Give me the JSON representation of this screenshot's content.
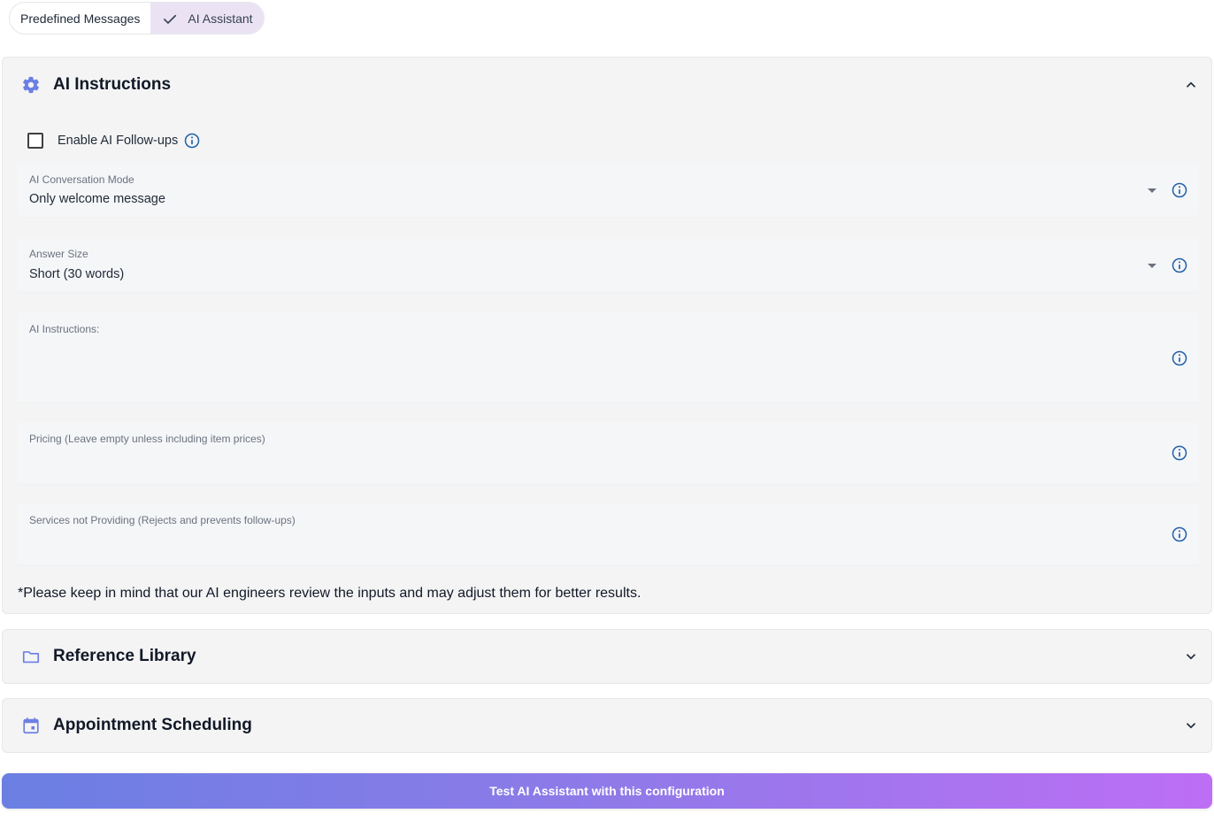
{
  "tabs": {
    "predefined_label": "Predefined Messages",
    "ai_assistant_label": "AI Assistant",
    "active": "AI Assistant"
  },
  "ai_instructions_panel": {
    "title": "AI Instructions",
    "expanded": true,
    "enable_followups": {
      "label": "Enable AI Follow-ups",
      "checked": false
    },
    "conversation_mode": {
      "label": "AI Conversation Mode",
      "value": "Only welcome message"
    },
    "answer_size": {
      "label": "Answer Size",
      "value": "Short (30 words)"
    },
    "instructions": {
      "label": "AI Instructions:",
      "value": ""
    },
    "pricing": {
      "label": "Pricing (Leave empty unless including item prices)",
      "value": ""
    },
    "services_not_providing": {
      "label": "Services not Providing (Rejects and prevents follow-ups)",
      "value": ""
    },
    "note": "*Please keep in mind that our AI engineers review the inputs and may adjust them for better results."
  },
  "reference_library_panel": {
    "title": "Reference Library",
    "expanded": false
  },
  "appointment_panel": {
    "title": "Appointment Scheduling",
    "expanded": false
  },
  "test_button_label": "Test AI Assistant with this configuration",
  "colors": {
    "accent": "#6b7fe3",
    "info_blue": "#1f5fa8",
    "active_tab_bg": "#ebe3f4",
    "gradient_start": "#6b7fe3",
    "gradient_end": "#bd6ef5"
  },
  "icons": {
    "ai_instructions": "gear-icon",
    "reference_library": "folder-icon",
    "appointment": "calendar-icon",
    "info": "info-icon",
    "active_tab": "check-icon"
  }
}
